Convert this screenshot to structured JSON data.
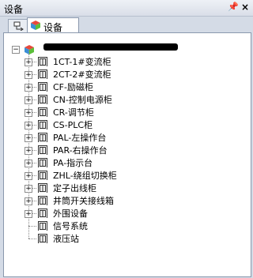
{
  "panel": {
    "title": "设备"
  },
  "tabs": [
    {
      "label": ""
    },
    {
      "label": "设备"
    }
  ],
  "tree": {
    "root": {
      "label_visible": false
    },
    "items": [
      {
        "label": "1CT-1#变流柜",
        "expandable": true
      },
      {
        "label": "2CT-2#变流柜",
        "expandable": true
      },
      {
        "label": "CF-励磁柜",
        "expandable": true
      },
      {
        "label": "CN-控制电源柜",
        "expandable": true
      },
      {
        "label": "CR-调节柜",
        "expandable": true
      },
      {
        "label": "CS-PLC柜",
        "expandable": true
      },
      {
        "label": "PAL-左操作台",
        "expandable": true
      },
      {
        "label": "PAR-右操作台",
        "expandable": true
      },
      {
        "label": "PA-指示台",
        "expandable": true
      },
      {
        "label": "ZHL-绕组切换柜",
        "expandable": true
      },
      {
        "label": "定子出线柜",
        "expandable": true
      },
      {
        "label": "井筒开关接线箱",
        "expandable": true
      },
      {
        "label": "外围设备",
        "expandable": true
      },
      {
        "label": "信号系统",
        "expandable": false
      },
      {
        "label": "液压站",
        "expandable": false
      }
    ]
  }
}
